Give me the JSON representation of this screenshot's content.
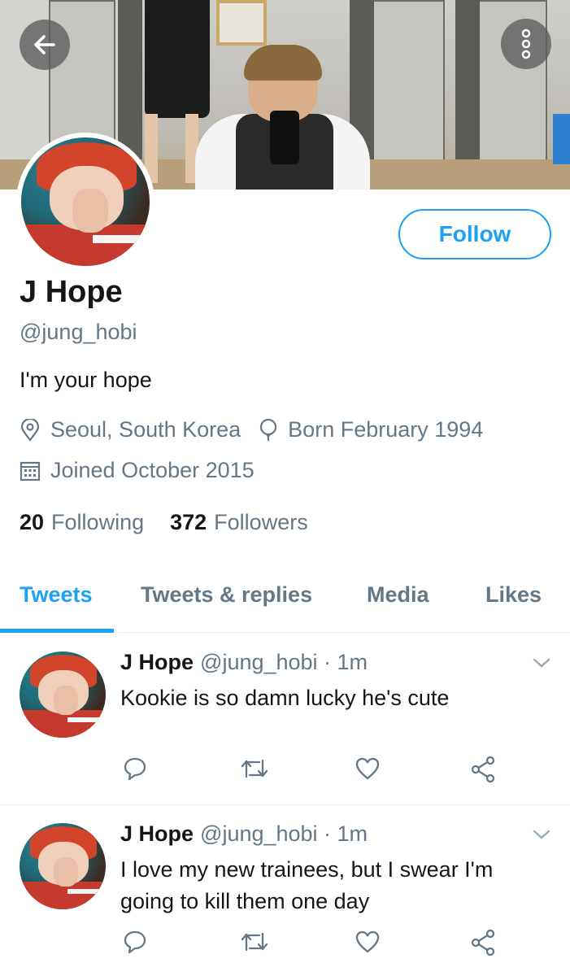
{
  "profile": {
    "name": "J Hope",
    "handle": "@jung_hobi",
    "bio": "I'm your hope",
    "location": "Seoul, South Korea",
    "birthday": "Born February 1994",
    "joined": "Joined October 2015",
    "following_count": "20",
    "following_label": "Following",
    "followers_count": "372",
    "followers_label": "Followers",
    "follow_label": "Follow"
  },
  "tabs": [
    {
      "label": "Tweets",
      "active": true
    },
    {
      "label": "Tweets & replies",
      "active": false
    },
    {
      "label": "Media",
      "active": false
    },
    {
      "label": "Likes",
      "active": false
    }
  ],
  "tweets": [
    {
      "name": "J Hope",
      "meta": "@jung_hobi · 1m",
      "text": "Kookie is so damn lucky he's cute"
    },
    {
      "name": "J Hope",
      "meta": "@jung_hobi · 1m",
      "text": "I love my new trainees, but I swear I'm going to kill them one day"
    }
  ],
  "icons": {
    "back": "arrow-left-icon",
    "more": "more-vertical-icon",
    "location": "location-pin-icon",
    "birthday": "balloon-icon",
    "joined": "calendar-icon",
    "reply": "reply-icon",
    "retweet": "retweet-icon",
    "like": "heart-icon",
    "share": "share-icon",
    "caret": "chevron-down-icon"
  },
  "colors": {
    "accent": "#1da1f2",
    "text_primary": "#14171a",
    "text_secondary": "#657786",
    "divider": "#e6ecf0"
  }
}
